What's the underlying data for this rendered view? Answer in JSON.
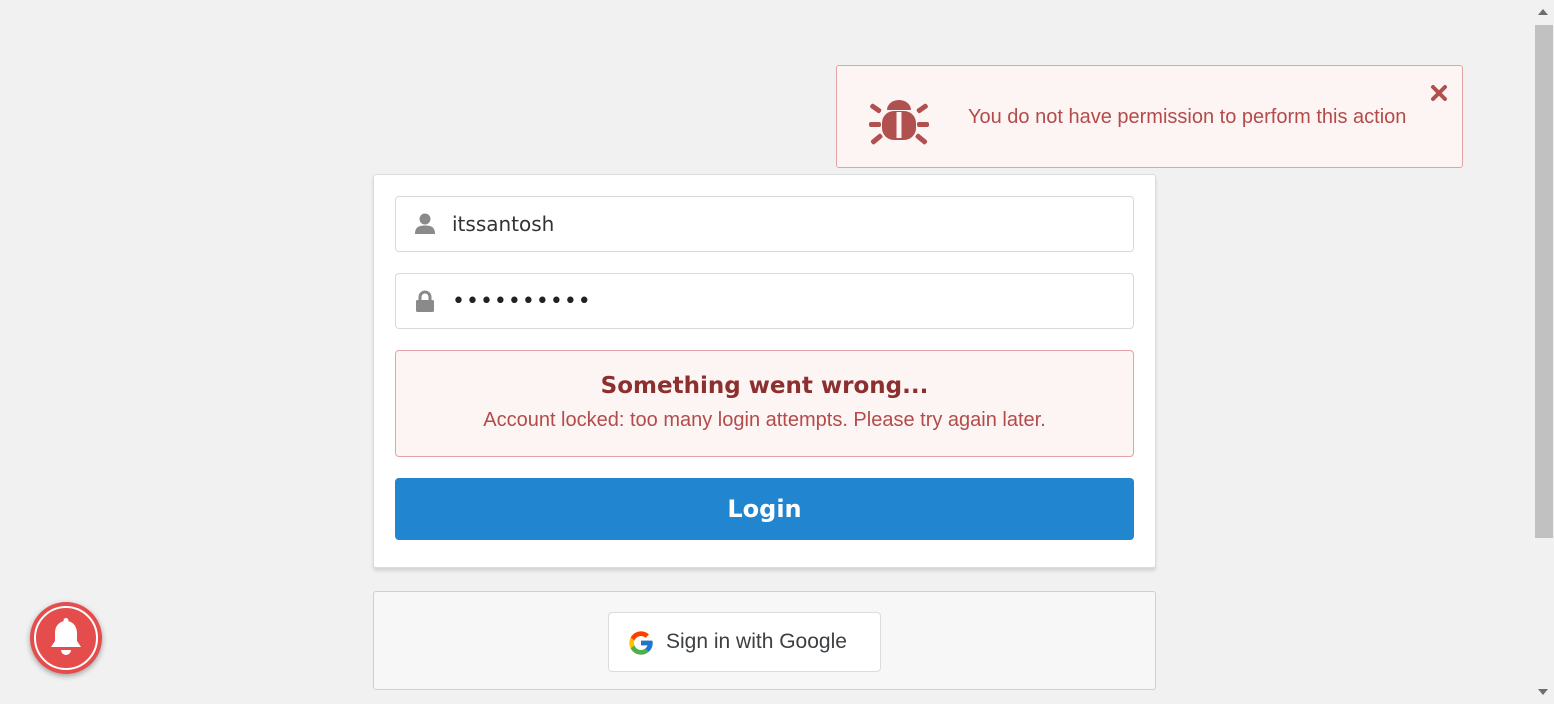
{
  "toast": {
    "message": "You do not have permission to perform this action",
    "icon": "bug-icon",
    "close_icon": "close-icon",
    "color": "#b34b4b"
  },
  "login": {
    "username": {
      "value": "itssantosh",
      "icon": "user-icon"
    },
    "password": {
      "value": "••••••••••",
      "icon": "lock-icon"
    },
    "error": {
      "title": "Something went wrong...",
      "message": "Account locked: too many login attempts. Please try again later."
    },
    "login_button_label": "Login",
    "button_color": "#2185d0"
  },
  "google": {
    "button_label": "Sign in with Google",
    "icon": "google-logo-icon"
  },
  "notifications": {
    "icon": "bell-icon",
    "color": "#e54d4d"
  }
}
